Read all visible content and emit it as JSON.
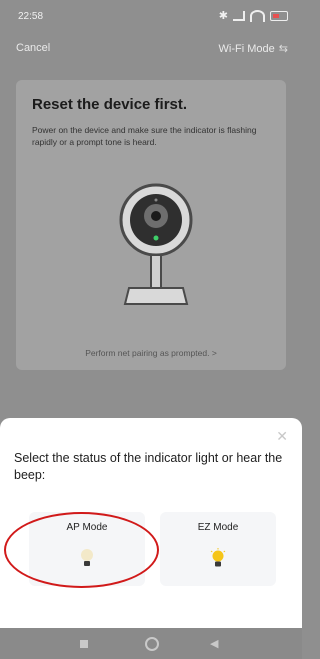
{
  "status_bar": {
    "time": "22:58"
  },
  "nav": {
    "cancel": "Cancel",
    "mode": "Wi-Fi Mode"
  },
  "card": {
    "title": "Reset the device first.",
    "description": "Power on the device and make sure the indicator is flashing rapidly or a prompt tone is heard.",
    "link": "Perform net pairing as prompted. >"
  },
  "sheet": {
    "prompt": "Select the status of the indicator light or hear the beep:",
    "modes": [
      {
        "label": "AP Mode",
        "icon": "bulb-dim-icon"
      },
      {
        "label": "EZ Mode",
        "icon": "bulb-lit-icon"
      }
    ]
  },
  "colors": {
    "annotation": "#d11a1a",
    "bulb_lit": "#f5c518",
    "dim_overlay": "#8f8f8f"
  }
}
